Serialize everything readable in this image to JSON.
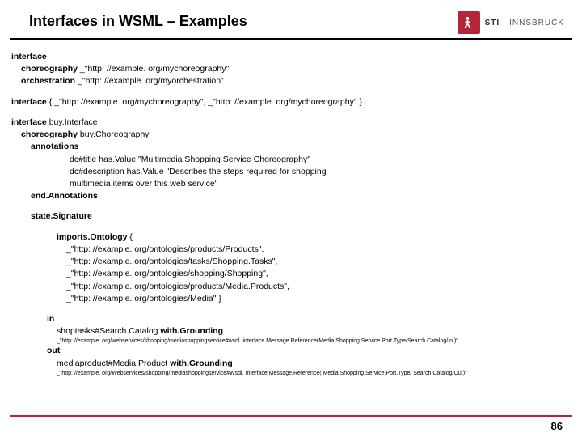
{
  "header": {
    "title": "Interfaces in WSML – Examples"
  },
  "brand": {
    "bold": "STI",
    "sep": " · ",
    "rest": "INNSBRUCK"
  },
  "kw": {
    "interface": "interface",
    "choreography": "choreography",
    "orchestration": "orchestration",
    "annotations": "annotations",
    "endAnnotations": "end.Annotations",
    "stateSignature": "state.Signature",
    "importsOntology": "imports.Ontology",
    "in": "in",
    "out": "out",
    "withGrounding": "with.Grounding"
  },
  "b1": {
    "chor": " _\"http: //example. org/mychoreography\"",
    "orch": " _\"http: //example. org/myorchestration\""
  },
  "b2": {
    "set": " { _\"http: //example. org/mychoreography\",  _\"http: //example. org/mychoreography\" }"
  },
  "b3": {
    "iface": " buy.Interface",
    "chor": " buy.Choreography",
    "a1": "dc#title has.Value \"Multimedia Shopping Service Choreography\"",
    "a2": "dc#description has.Value \"Describes the steps required for shopping",
    "a3": "multimedia items over this web service\""
  },
  "imports": {
    "open": " {",
    "l1": "_\"http: //example. org/ontologies/products/Products\",",
    "l2": "_\"http: //example. org/ontologies/tasks/Shopping.Tasks\",",
    "l3": "_\"http: //example. org/ontologies/shopping/Shopping\",",
    "l4": "_\"http: //example. org/ontologies/products/Media.Products\",",
    "l5": "_\"http: //example. org/ontologies/Media\" }"
  },
  "io": {
    "inItem": "shoptasks#Search.Catalog ",
    "inGround": "_\"http: //example. org/webservices/shopping/mediashoppingservice#wsdl. interface.Message.Reference(Media.Shopping.Service.Port.Type/Search.Catalog/In )\"",
    "outItem": "mediaproduct#Media.Product ",
    "outGround": "_\"http: //example. org/Webservices/shopping/mediashoppingservice#Wsdl. Interface.Message.Reference( Media.Shopping.Service.Port.Type/ Search.Catalog/Out)\""
  },
  "page": "86"
}
